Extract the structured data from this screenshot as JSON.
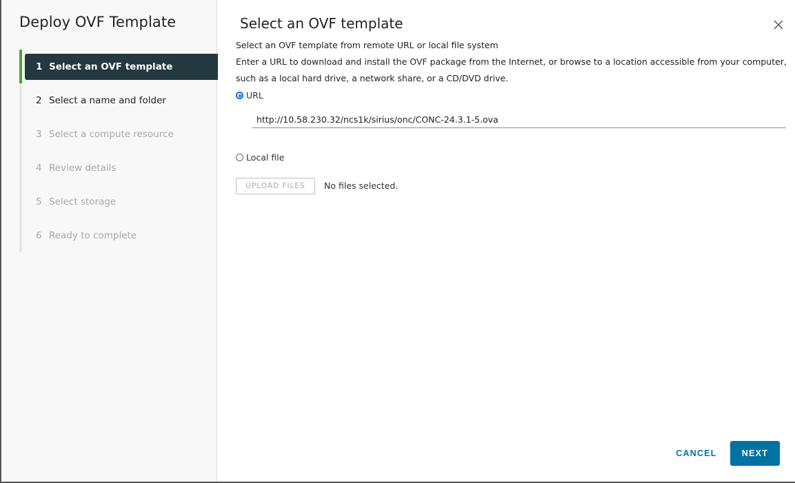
{
  "wizard": {
    "title": "Deploy OVF Template",
    "steps": [
      {
        "number": "1",
        "label": "Select an OVF template",
        "state": "active"
      },
      {
        "number": "2",
        "label": "Select a name and folder",
        "state": "enabled"
      },
      {
        "number": "3",
        "label": "Select a compute resource",
        "state": "disabled"
      },
      {
        "number": "4",
        "label": "Review details",
        "state": "disabled"
      },
      {
        "number": "5",
        "label": "Select storage",
        "state": "disabled"
      },
      {
        "number": "6",
        "label": "Ready to complete",
        "state": "disabled"
      }
    ]
  },
  "page": {
    "title": "Select an OVF template",
    "subtitle": "Select an OVF template from remote URL or local file system",
    "description_line1": "Enter a URL to download and install the OVF package from the Internet, or browse to a location accessible from your computer,",
    "description_line2": "such as a local hard drive, a network share, or a CD/DVD drive.",
    "url_option": {
      "label": "URL",
      "selected": true
    },
    "url_value": "http://10.58.230.32/ncs1k/sirius/onc/CONC-24.3.1-5.ova",
    "local_file_option": {
      "label": "Local file",
      "selected": false
    },
    "upload_button": "UPLOAD FILES",
    "no_files_text": "No files selected."
  },
  "footer": {
    "cancel_label": "CANCEL",
    "next_label": "NEXT"
  },
  "colors": {
    "accent": "#0072a3",
    "active_step_bg": "#23383f",
    "progress_green": "#48a830",
    "radio_blue": "#0a6cd8"
  }
}
